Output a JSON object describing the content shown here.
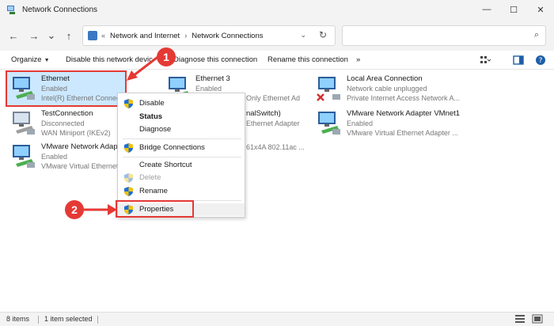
{
  "window": {
    "title": "Network Connections",
    "minimize": "—",
    "maximize": "☐",
    "close": "✕"
  },
  "nav": {
    "back": "←",
    "forward": "→",
    "recent": "⌄",
    "up": "↑"
  },
  "address": {
    "chevrons": "«",
    "crumbs": [
      "Network and Internet",
      "Network Connections"
    ],
    "separator": "›",
    "dropdown": "⌄",
    "refresh": "↻"
  },
  "search": {
    "placeholder": "",
    "icon": "⌕"
  },
  "commands": {
    "organize": "Organize",
    "disable": "Disable this network device",
    "diagnose": "Diagnose this connection",
    "rename": "Rename this connection",
    "more": "»"
  },
  "connections": [
    {
      "name": "Ethernet",
      "status": "Enabled",
      "adapter": "Intel(R) Ethernet Connection",
      "selected": true
    },
    {
      "name": "Ethernet 3",
      "status": "Enabled",
      "adapter": "Only Ethernet Ad"
    },
    {
      "name": "Local Area Connection",
      "status": "Network cable unplugged",
      "adapter": "Private Internet Access Network A..."
    },
    {
      "name": "TestConnection",
      "status": "Disconnected",
      "adapter": "WAN Miniport (IKEv2)"
    },
    {
      "name": "nalSwitch)",
      "status": "",
      "adapter": "Ethernet Adapter"
    },
    {
      "name": "VMware Network Adapter VMnet1",
      "status": "Enabled",
      "adapter": "VMware Virtual Ethernet Adapter ..."
    },
    {
      "name": "VMware Network Adapter",
      "status": "Enabled",
      "adapter": "VMware Virtual Ethernet Adapter"
    },
    {
      "name": "",
      "status": "",
      "adapter": "61x4A 802.11ac ..."
    }
  ],
  "context_menu": {
    "items": [
      "Disable",
      "Status",
      "Diagnose",
      "Bridge Connections",
      "Create Shortcut",
      "Delete",
      "Rename",
      "Properties"
    ]
  },
  "callouts": {
    "one": "1",
    "two": "2"
  },
  "status": {
    "count": "8 items",
    "selected": "1 item selected"
  },
  "colors": {
    "accent": "#0078d4",
    "selection": "#cce8ff",
    "callout": "#e53935"
  }
}
